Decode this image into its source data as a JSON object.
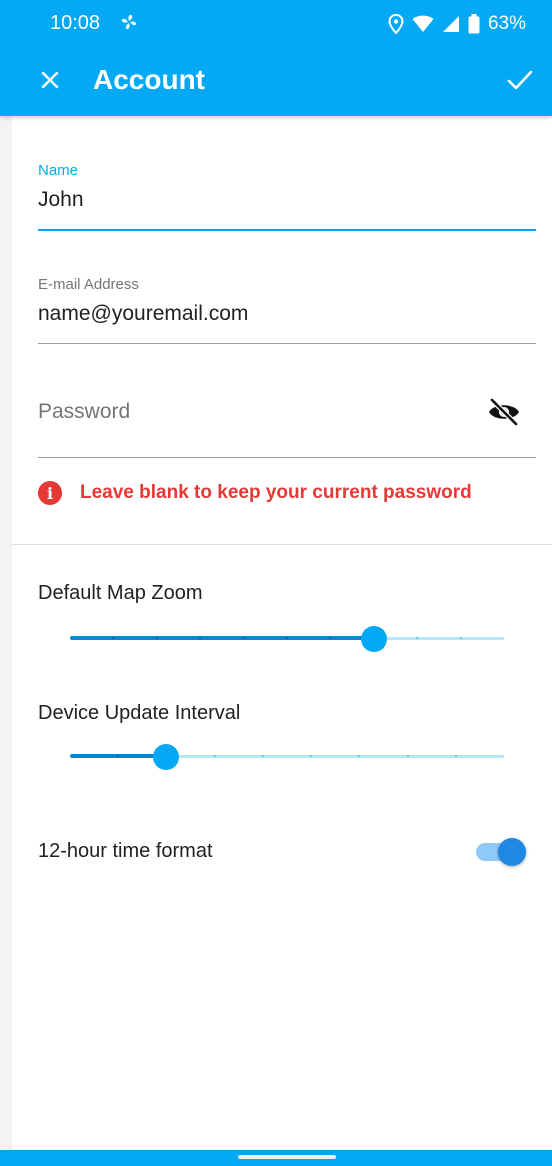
{
  "status_bar": {
    "time": "10:08",
    "battery": "63%",
    "icons": [
      "fan-icon",
      "location-icon",
      "wifi-icon",
      "signal-icon",
      "battery-icon"
    ]
  },
  "toolbar": {
    "title": "Account",
    "close_icon": "close-icon",
    "confirm_icon": "check-icon"
  },
  "form": {
    "name": {
      "label": "Name",
      "value": "John"
    },
    "email": {
      "label": "E-mail Address",
      "value": "name@youremail.com"
    },
    "password": {
      "placeholder": "Password",
      "toggle_icon": "visibility-off-icon"
    },
    "helper": {
      "icon": "info-icon",
      "text": "Leave blank to keep your current password"
    }
  },
  "settings": {
    "map_zoom": {
      "label": "Default Map Zoom",
      "steps": 10,
      "value": 7
    },
    "update_interval": {
      "label": "Device Update Interval",
      "steps": 9,
      "value": 2
    },
    "time_format": {
      "label": "12-hour time format",
      "enabled": true
    }
  },
  "colors": {
    "primary": "#03a9f4",
    "error": "#e53935",
    "switch_on": "#1e88e5"
  }
}
